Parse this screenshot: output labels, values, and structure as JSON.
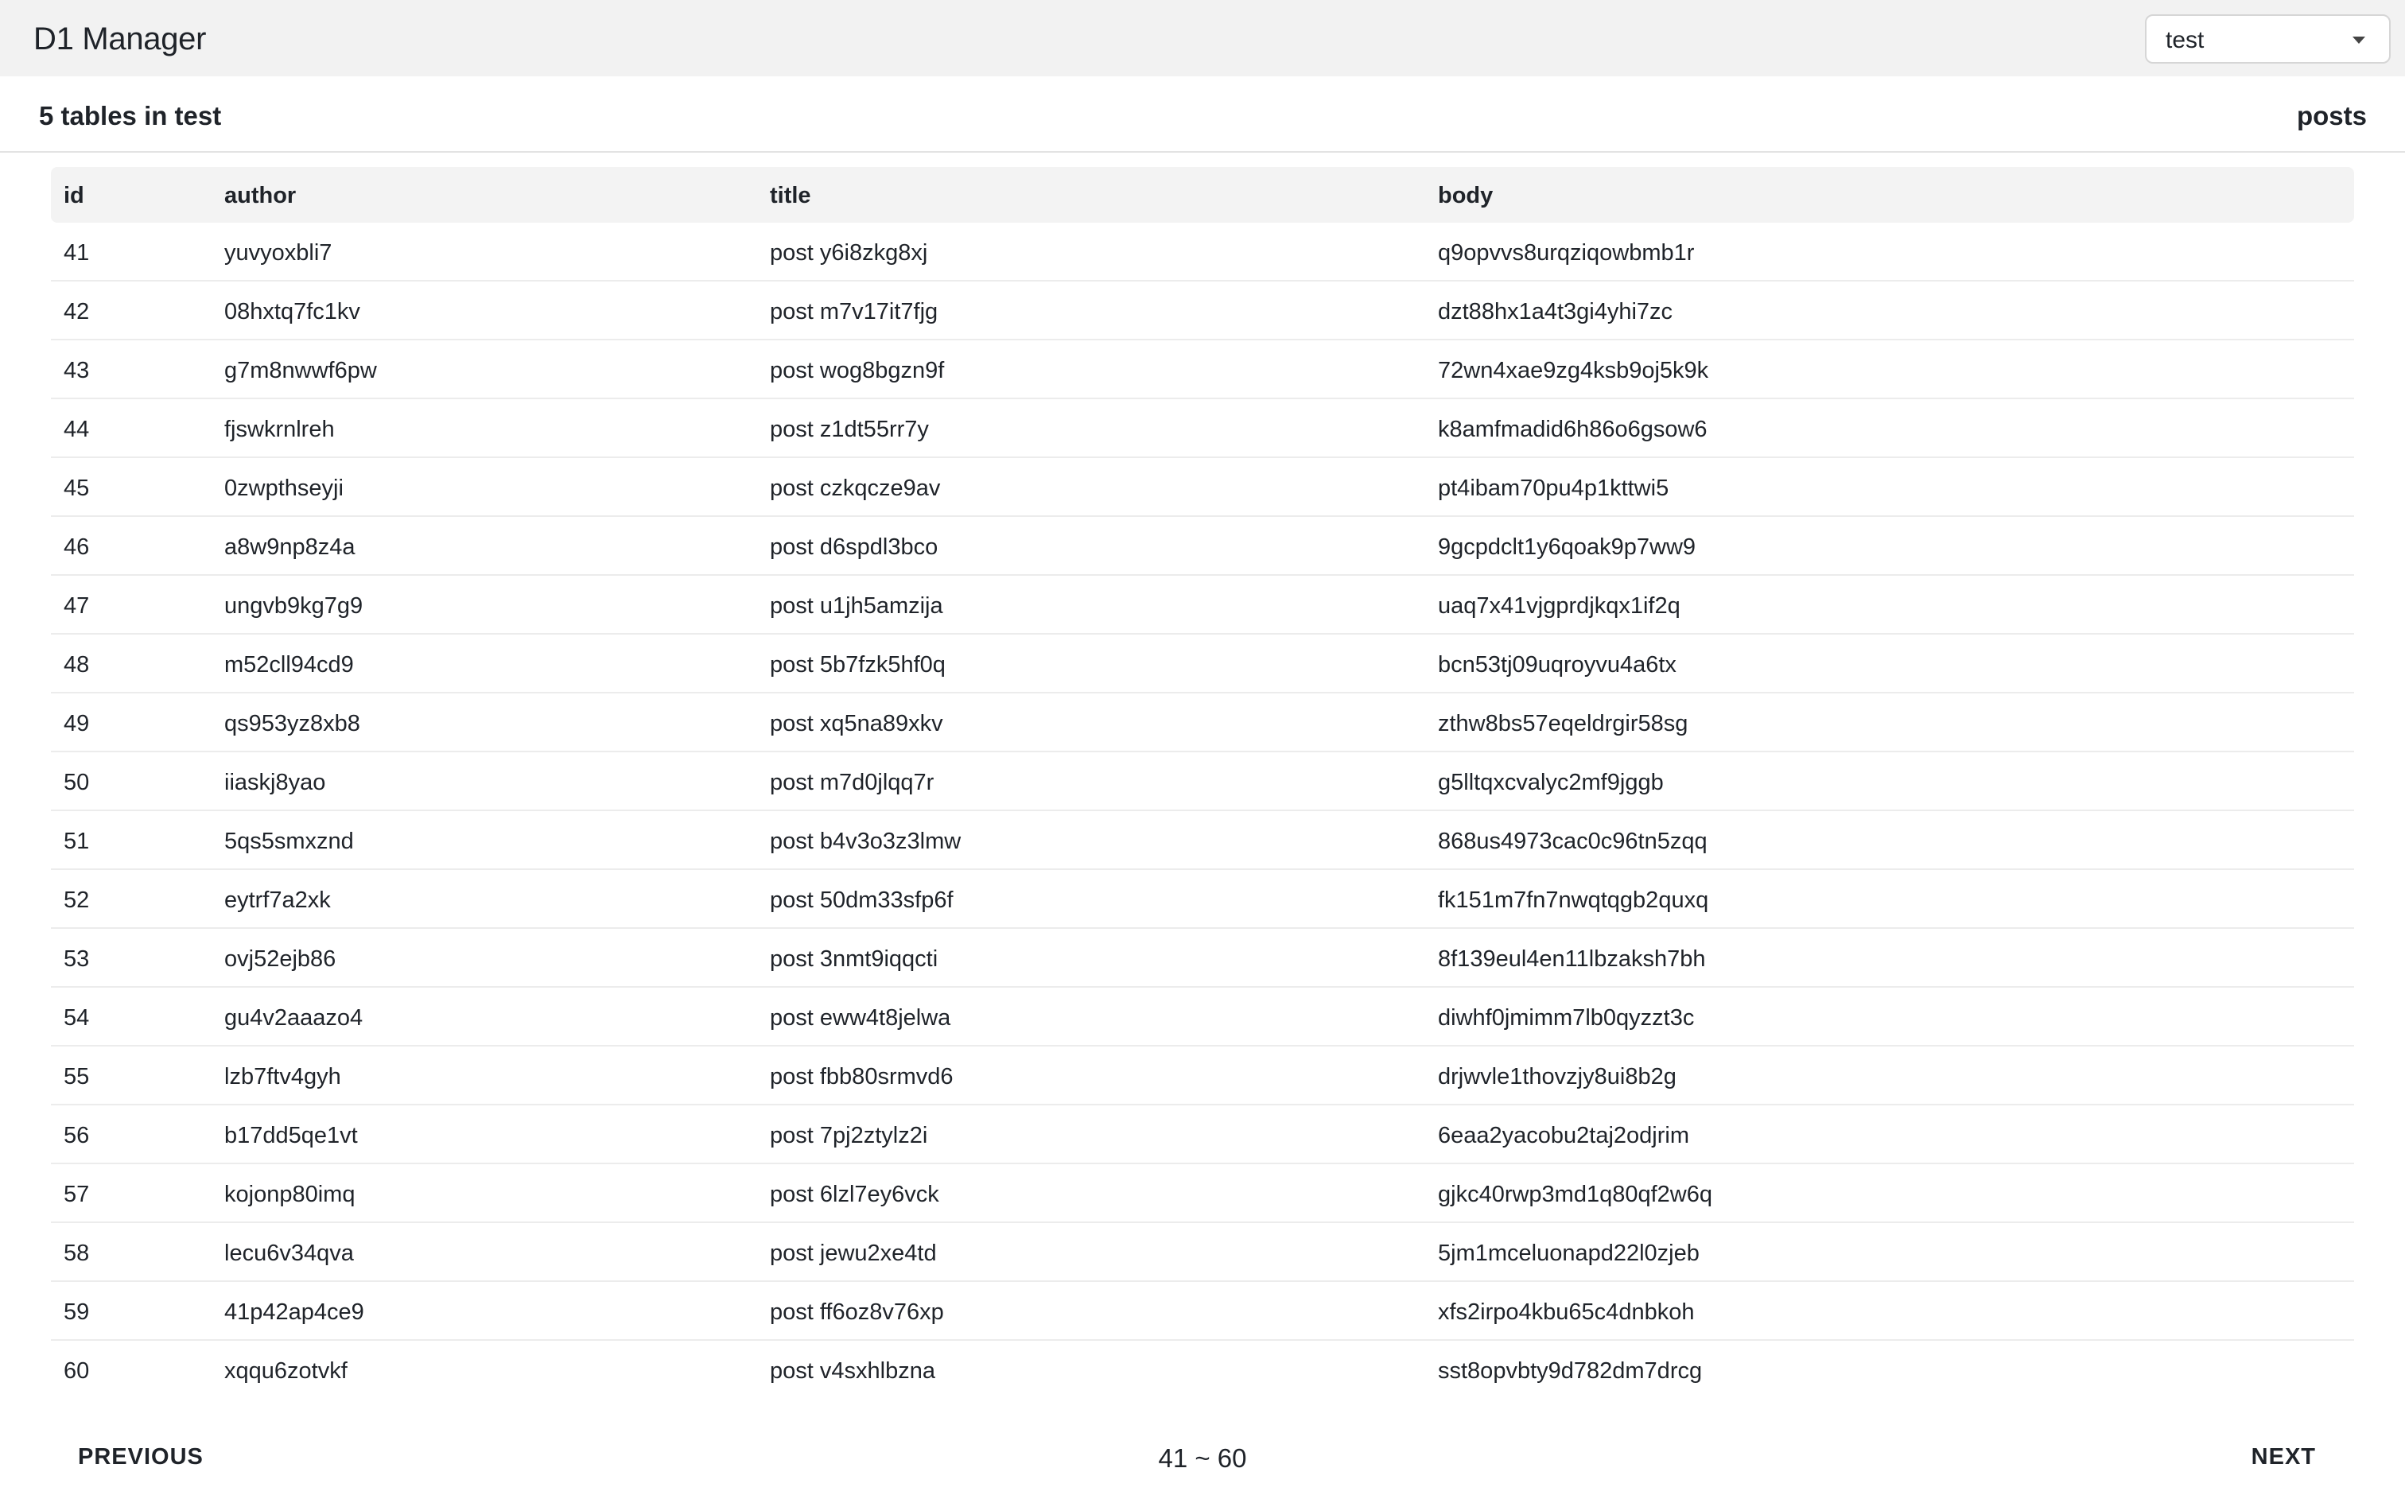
{
  "header": {
    "app_title": "D1 Manager",
    "database_select": {
      "selected": "test"
    }
  },
  "subheader": {
    "tables_count_text": "5 tables in test",
    "current_table": "posts"
  },
  "table": {
    "columns": [
      "id",
      "author",
      "title",
      "body"
    ],
    "rows": [
      [
        "41",
        "yuvyoxbli7",
        "post y6i8zkg8xj",
        "q9opvvs8urqziqowbmb1r"
      ],
      [
        "42",
        "08hxtq7fc1kv",
        "post m7v17it7fjg",
        "dzt88hx1a4t3gi4yhi7zc"
      ],
      [
        "43",
        "g7m8nwwf6pw",
        "post wog8bgzn9f",
        "72wn4xae9zg4ksb9oj5k9k"
      ],
      [
        "44",
        "fjswkrnlreh",
        "post z1dt55rr7y",
        "k8amfmadid6h86o6gsow6"
      ],
      [
        "45",
        "0zwpthseyji",
        "post czkqcze9av",
        "pt4ibam70pu4p1kttwi5"
      ],
      [
        "46",
        "a8w9np8z4a",
        "post d6spdl3bco",
        "9gcpdclt1y6qoak9p7ww9"
      ],
      [
        "47",
        "ungvb9kg7g9",
        "post u1jh5amzija",
        "uaq7x41vjgprdjkqx1if2q"
      ],
      [
        "48",
        "m52cll94cd9",
        "post 5b7fzk5hf0q",
        "bcn53tj09uqroyvu4a6tx"
      ],
      [
        "49",
        "qs953yz8xb8",
        "post xq5na89xkv",
        "zthw8bs57eqeldrgir58sg"
      ],
      [
        "50",
        "iiaskj8yao",
        "post m7d0jlqq7r",
        "g5lltqxcvalyc2mf9jggb"
      ],
      [
        "51",
        "5qs5smxznd",
        "post b4v3o3z3lmw",
        "868us4973cac0c96tn5zqq"
      ],
      [
        "52",
        "eytrf7a2xk",
        "post 50dm33sfp6f",
        "fk151m7fn7nwqtqgb2quxq"
      ],
      [
        "53",
        "ovj52ejb86",
        "post 3nmt9iqqcti",
        "8f139eul4en11lbzaksh7bh"
      ],
      [
        "54",
        "gu4v2aaazo4",
        "post eww4t8jelwa",
        "diwhf0jmimm7lb0qyzzt3c"
      ],
      [
        "55",
        "lzb7ftv4gyh",
        "post fbb80srmvd6",
        "drjwvle1thovzjy8ui8b2g"
      ],
      [
        "56",
        "b17dd5qe1vt",
        "post 7pj2ztylz2i",
        "6eaa2yacobu2taj2odjrim"
      ],
      [
        "57",
        "kojonp80imq",
        "post 6lzl7ey6vck",
        "gjkc40rwp3md1q80qf2w6q"
      ],
      [
        "58",
        "lecu6v34qva",
        "post jewu2xe4td",
        "5jm1mceluonapd22l0zjeb"
      ],
      [
        "59",
        "41p42ap4ce9",
        "post ff6oz8v76xp",
        "xfs2irpo4kbu65c4dnbkoh"
      ],
      [
        "60",
        "xqqu6zotvkf",
        "post v4sxhlbzna",
        "sst8opvbty9d782dm7drcg"
      ]
    ]
  },
  "pagination": {
    "previous_label": "PREVIOUS",
    "range_text": "41 ~ 60",
    "next_label": "NEXT"
  }
}
